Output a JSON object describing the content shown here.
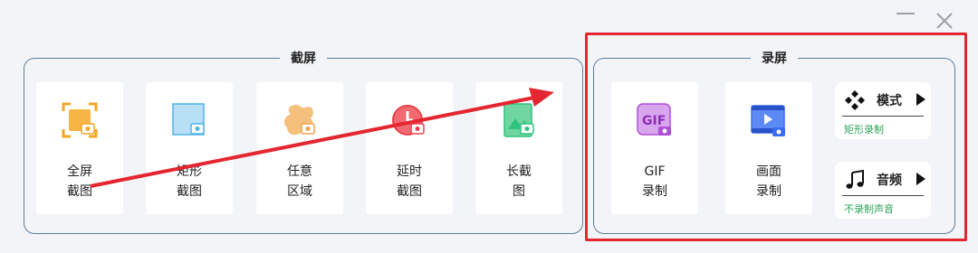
{
  "screenshot_group": {
    "title": "截屏",
    "tiles": [
      {
        "line1": "全屏",
        "line2": "截图",
        "icon": "fullscreen-capture-icon",
        "color": "#f5a623"
      },
      {
        "line1": "矩形",
        "line2": "截图",
        "icon": "rectangle-capture-icon",
        "color": "#4fb3e8"
      },
      {
        "line1": "任意",
        "line2": "区域",
        "icon": "freeform-capture-icon",
        "color": "#f0a24a"
      },
      {
        "line1": "延时",
        "line2": "截图",
        "icon": "delayed-capture-icon",
        "color": "#e8424c"
      },
      {
        "line1": "长截",
        "line2": "图",
        "icon": "scrolling-capture-icon",
        "color": "#2ec27e"
      }
    ]
  },
  "record_group": {
    "title": "录屏",
    "tiles": [
      {
        "line1": "GIF",
        "line2": "录制",
        "icon": "gif-record-icon",
        "color": "#b04fd6"
      },
      {
        "line1": "画面",
        "line2": "录制",
        "icon": "screen-record-icon",
        "color": "#3b6cf0"
      }
    ],
    "mode": {
      "title": "模式",
      "sub": "矩形录制",
      "icon": "mode-diamond-icon"
    },
    "audio": {
      "title": "音频",
      "sub": "不录制声音",
      "icon": "music-note-icon"
    }
  },
  "colors": {
    "accent_green": "#2fa35a",
    "highlight_red": "#e3262f",
    "border_blue": "#5a7fa3"
  }
}
